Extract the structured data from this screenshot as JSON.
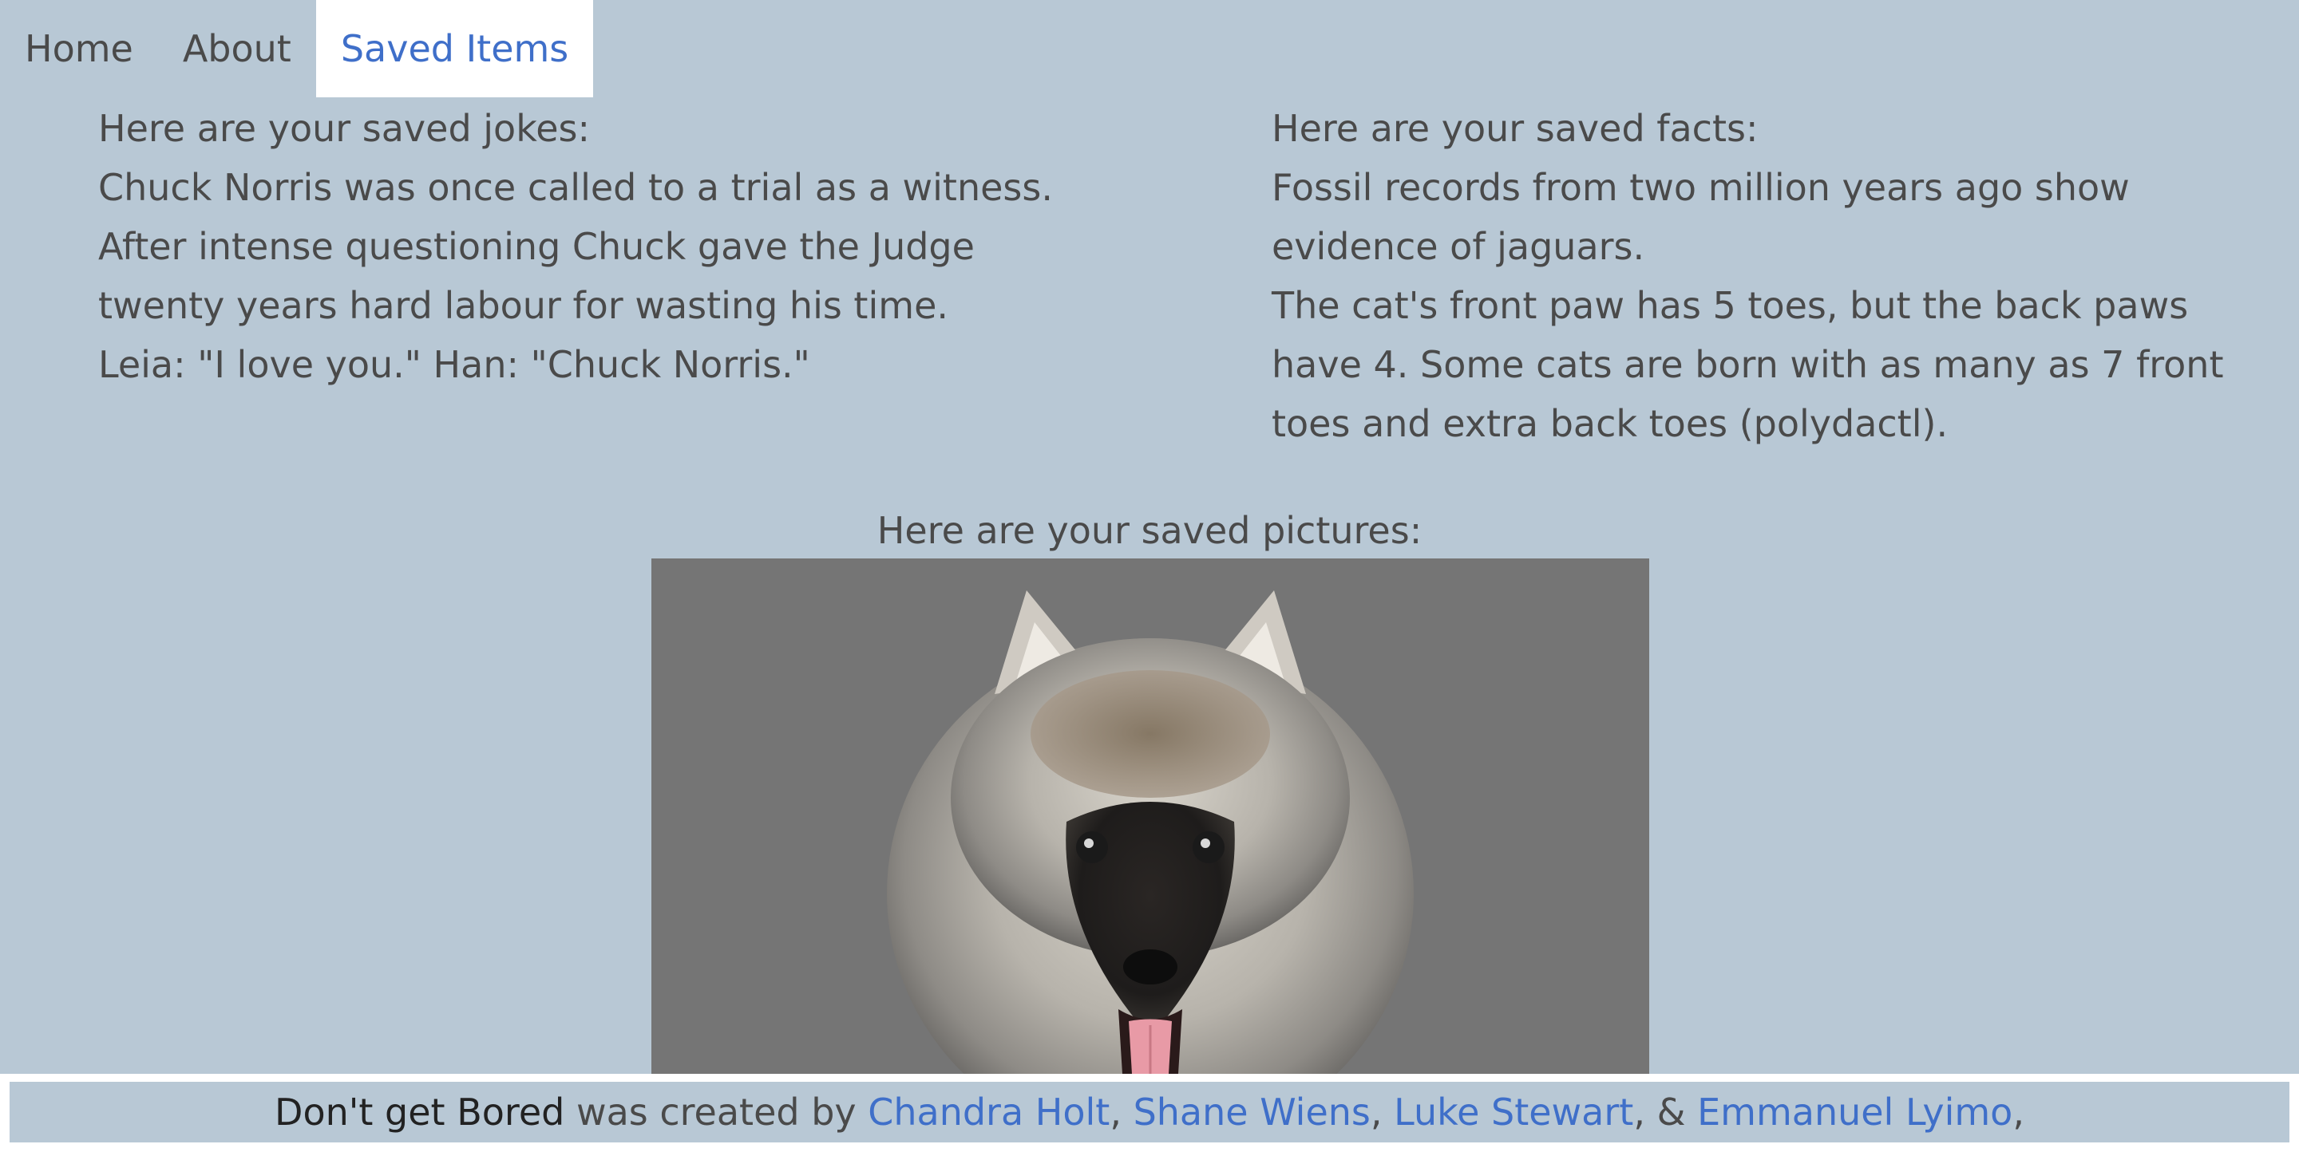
{
  "nav": {
    "tabs": [
      {
        "label": "Home"
      },
      {
        "label": "About"
      },
      {
        "label": "Saved Items"
      }
    ],
    "active_tab": "Saved Items"
  },
  "jokes": {
    "heading": "Here are your saved jokes:",
    "items": [
      "Chuck Norris was once called to a trial as a witness. After intense questioning Chuck gave the Judge twenty years hard labour for wasting his time.",
      "Leia: \"I love you.\" Han: \"Chuck Norris.\""
    ]
  },
  "facts": {
    "heading": "Here are your saved facts:",
    "items": [
      "Fossil records from two million years ago show evidence of jaguars.",
      "The cat's front paw has 5 toes, but the back paws have 4. Some cats are born with as many as 7 front toes and extra back toes (polydactl)."
    ]
  },
  "pictures": {
    "heading": "Here are your saved pictures:",
    "items": [
      {
        "subject": "puppy-photo"
      }
    ]
  },
  "footer": {
    "brand": "Don't get Bored",
    "created_by": " was created by ",
    "authors": [
      "Chandra Holt",
      "Shane Wiens",
      "Luke Stewart",
      "Emmanuel Lyimo"
    ],
    "sep_comma": ", ",
    "sep_amp": ", & ",
    "trailing": ","
  },
  "colors": {
    "background": "#b8c8d5",
    "link": "#3f6fc9",
    "active_tab_bg": "#ffffff",
    "text": "#4a4a4a"
  }
}
